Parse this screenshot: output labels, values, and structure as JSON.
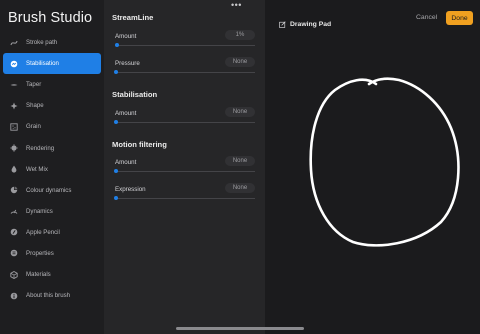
{
  "app": {
    "title": "Brush Studio"
  },
  "sidebar": {
    "items": [
      {
        "label": "Stroke path",
        "icon": "stroke-path-icon",
        "active": false
      },
      {
        "label": "Stabilisation",
        "icon": "stabilisation-icon",
        "active": true
      },
      {
        "label": "Taper",
        "icon": "taper-icon",
        "active": false
      },
      {
        "label": "Shape",
        "icon": "shape-icon",
        "active": false
      },
      {
        "label": "Grain",
        "icon": "grain-icon",
        "active": false
      },
      {
        "label": "Rendering",
        "icon": "rendering-icon",
        "active": false
      },
      {
        "label": "Wet Mix",
        "icon": "wet-mix-icon",
        "active": false
      },
      {
        "label": "Colour dynamics",
        "icon": "colour-dynamics-icon",
        "active": false
      },
      {
        "label": "Dynamics",
        "icon": "dynamics-icon",
        "active": false
      },
      {
        "label": "Apple Pencil",
        "icon": "apple-pencil-icon",
        "active": false
      },
      {
        "label": "Properties",
        "icon": "properties-icon",
        "active": false
      },
      {
        "label": "Materials",
        "icon": "materials-icon",
        "active": false
      },
      {
        "label": "About this brush",
        "icon": "info-icon",
        "active": false
      }
    ]
  },
  "settings": {
    "more_icon": "more-horizontal-icon",
    "sections": [
      {
        "title": "StreamLine",
        "params": [
          {
            "label": "Amount",
            "value": "1%",
            "level": 0.01
          },
          {
            "label": "Pressure",
            "value": "None",
            "level": 0
          }
        ]
      },
      {
        "title": "Stabilisation",
        "params": [
          {
            "label": "Amount",
            "value": "None",
            "level": 0
          }
        ]
      },
      {
        "title": "Motion filtering",
        "params": [
          {
            "label": "Amount",
            "value": "None",
            "level": 0
          },
          {
            "label": "Expression",
            "value": "None",
            "level": 0
          }
        ]
      }
    ]
  },
  "drawing_pad": {
    "title": "Drawing Pad",
    "title_icon": "edit-pencil-icon",
    "cancel_label": "Cancel",
    "done_label": "Done"
  },
  "colors": {
    "accent": "#1f7fe6",
    "done_button": "#f0a020",
    "panel_background": "#262628",
    "sidebar_background": "#1e1e20"
  }
}
